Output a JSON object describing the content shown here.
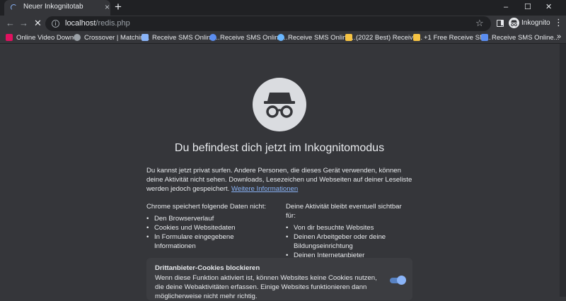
{
  "tabs": [
    {
      "title": "Neuer Inkognitotab",
      "close_icon": "×"
    }
  ],
  "new_tab_icon": "+",
  "window_controls": {
    "minimize": "–",
    "maximize": "☐",
    "close": "✕"
  },
  "toolbar": {
    "back": "←",
    "forward": "→",
    "stop": "✕",
    "info_icon": "i",
    "url_host": "localhost",
    "url_path": "/redis.php",
    "star_icon": "☆",
    "profile_label": "Inkognito",
    "menu_icon": "⋮"
  },
  "bookmarks": [
    {
      "label": "Online Video Down...",
      "color": "#e0115f"
    },
    {
      "label": "Crossover | Matchin...",
      "color": "#9aa0a6"
    },
    {
      "label": "Receive SMS Online...",
      "color": "#8ab4f8"
    },
    {
      "label": "Receive SMS Online...",
      "color": "#5b8def"
    },
    {
      "label": "Receive SMS Online...",
      "color": "#6ab7ff"
    },
    {
      "label": "(2022 Best) Receive...",
      "color": "#f6c343"
    },
    {
      "label": "+1 Free Receive SM...",
      "color": "#f6c343"
    },
    {
      "label": "Receive SMS Online...",
      "color": "#5b8def"
    }
  ],
  "bookmarks_more": "»",
  "page": {
    "heading": "Du befindest dich jetzt im Inkognitomodus",
    "intro": "Du kannst jetzt privat surfen. Andere Personen, die dieses Gerät verwenden, können deine Aktivität nicht sehen. Downloads, Lesezeichen und Webseiten auf deiner Leseliste werden jedoch gespeichert.",
    "learn_more": "Weitere Informationen",
    "not_saved_title": "Chrome speichert folgende Daten nicht:",
    "not_saved": [
      "Den Browserverlauf",
      "Cookies und Websitedaten",
      "In Formulare eingegebene Informationen"
    ],
    "visible_title": "Deine Aktivität bleibt eventuell sichtbar für:",
    "visible": [
      "Von dir besuchte Websites",
      "Deinen Arbeitgeber oder deine Bildungseinrichtung",
      "Deinen Internetanbieter"
    ],
    "cookie_title": "Drittanbieter-Cookies blockieren",
    "cookie_desc": "Wenn diese Funktion aktiviert ist, können Websites keine Cookies nutzen, die deine Webaktivitäten erfassen. Einige Websites funktionieren dann möglicherweise nicht mehr richtig.",
    "cookie_toggle_on": true
  },
  "colors": {
    "background": "#35363a",
    "frame": "#202124",
    "link": "#8ab4f8",
    "toggle": "#8ab4f8"
  }
}
